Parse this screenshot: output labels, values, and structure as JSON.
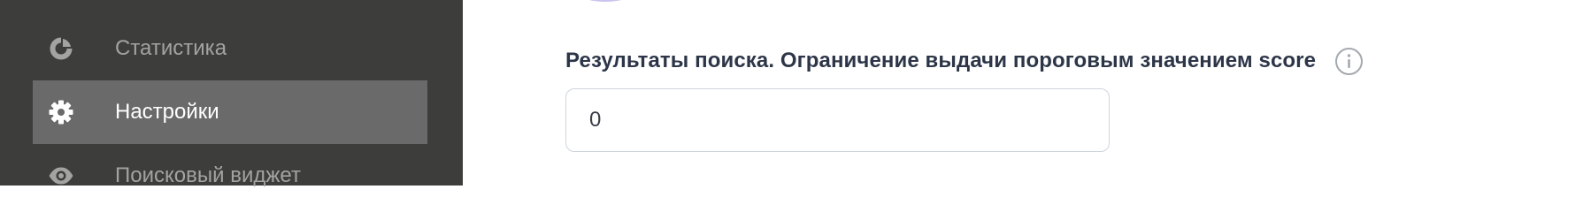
{
  "sidebar": {
    "items": [
      {
        "label": "Статистика",
        "icon": "chart-pie-icon",
        "active": false
      },
      {
        "label": "Настройки",
        "icon": "gear-icon",
        "active": true
      },
      {
        "label": "Поисковый виджет",
        "icon": "eye-icon",
        "active": false
      }
    ]
  },
  "main": {
    "score_field": {
      "label": "Результаты поиска. Ограничение выдачи пороговым значением score",
      "value": "0",
      "info_icon": "info-icon"
    }
  },
  "colors": {
    "sidebar_bg": "#3d3d3b",
    "sidebar_active_bg": "#6a6a6a",
    "label_text": "#2d3648"
  }
}
